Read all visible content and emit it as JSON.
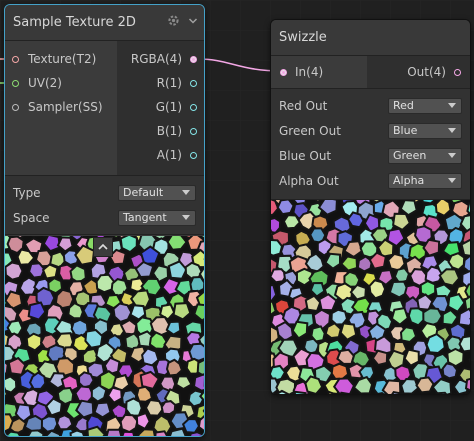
{
  "colors": {
    "background": "#202020",
    "node_bg": "#393939",
    "selection_outline": "#44a1c8",
    "connection": "#f3a7e5"
  },
  "sample_node": {
    "title": "Sample Texture 2D",
    "icons": [
      "gear-icon",
      "chevron-down-icon"
    ],
    "inputs": [
      {
        "label": "Texture(T2)",
        "color": "#f5a7a7"
      },
      {
        "label": "UV(2)",
        "color": "#8ddd72"
      },
      {
        "label": "Sampler(SS)",
        "color": "#c8c8c8"
      }
    ],
    "outputs": [
      {
        "label": "RGBA(4)",
        "color": "#f3a7e5"
      },
      {
        "label": "R(1)",
        "color": "#84e4e7"
      },
      {
        "label": "G(1)",
        "color": "#84e4e7"
      },
      {
        "label": "B(1)",
        "color": "#84e4e7"
      },
      {
        "label": "A(1)",
        "color": "#84e4e7"
      }
    ],
    "type_label": "Type",
    "type_value": "Default",
    "space_label": "Space",
    "space_value": "Tangent",
    "collapse_icon": "chevron-up-icon"
  },
  "swizzle_node": {
    "title": "Swizzle",
    "input": {
      "label": "In(4)",
      "color": "#f3a7e5"
    },
    "output": {
      "label": "Out(4)",
      "color": "#f3a7e5"
    },
    "props": [
      {
        "label": "Red Out",
        "value": "Red"
      },
      {
        "label": "Green Out",
        "value": "Blue"
      },
      {
        "label": "Blue Out",
        "value": "Green"
      },
      {
        "label": "Alpha Out",
        "value": "Alpha"
      }
    ]
  }
}
